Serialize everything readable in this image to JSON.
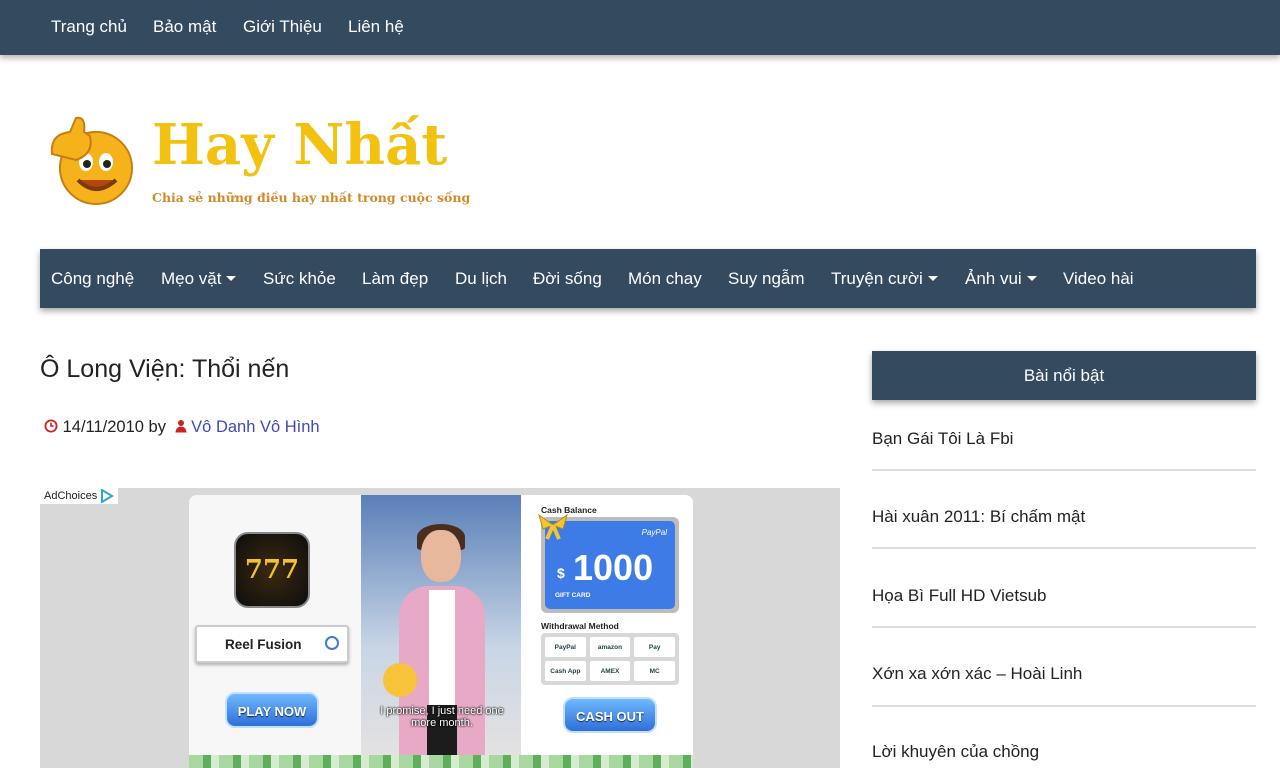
{
  "topnav": {
    "items": [
      "Trang chủ",
      "Bảo mật",
      "Giới Thiệu",
      "Liên hệ"
    ]
  },
  "logo": {
    "title": "Hay Nhất",
    "subtitle": "Chia sẻ những điều hay nhất trong cuộc sống"
  },
  "mainnav": {
    "items": [
      {
        "label": "Công nghệ",
        "dropdown": false
      },
      {
        "label": "Mẹo vặt",
        "dropdown": true
      },
      {
        "label": "Sức khỏe",
        "dropdown": false
      },
      {
        "label": "Làm đẹp",
        "dropdown": false
      },
      {
        "label": "Du lịch",
        "dropdown": false
      },
      {
        "label": "Đời sống",
        "dropdown": false
      },
      {
        "label": "Món chay",
        "dropdown": false
      },
      {
        "label": "Suy ngẫm",
        "dropdown": false
      },
      {
        "label": "Truyện cười",
        "dropdown": true
      },
      {
        "label": "Ảnh vui",
        "dropdown": true
      },
      {
        "label": "Video hài",
        "dropdown": false
      }
    ]
  },
  "post": {
    "title": "Ô Long Viện: Thổi nến",
    "date": "14/11/2010",
    "by": "by",
    "author": "Vô Danh Vô Hình"
  },
  "ad": {
    "adchoices": "AdChoices",
    "app_icon_text": "777",
    "app_name": "Reel Fusion",
    "play_button": "PLAY NOW",
    "caption": "I promise, I just need one more month.",
    "cash_balance_label": "Cash Balance",
    "paypal": "PayPal",
    "currency": "$",
    "amount": "1000",
    "gift_card": "GIFT CARD",
    "withdrawal_label": "Withdrawal Method",
    "methods": [
      "PayPal",
      "amazon",
      "Pay",
      "Cash App",
      "AMEX",
      "MC"
    ],
    "cashout_button": "CASH OUT"
  },
  "sidebar": {
    "heading": "Bài nổi bật",
    "items": [
      "Bạn Gái Tôi Là Fbi",
      "Hài xuân 2011: Bí chấm mật",
      "Họa Bì Full HD Vietsub",
      "Xớn xa xớn xác – Hoài Linh",
      "Lời khuyên của chồng"
    ]
  },
  "colors": {
    "nav_bg": "#344a5f",
    "logo_gold": "#f3c110",
    "author_link": "#4048b8",
    "meta_icon_red": "#cc2222"
  }
}
